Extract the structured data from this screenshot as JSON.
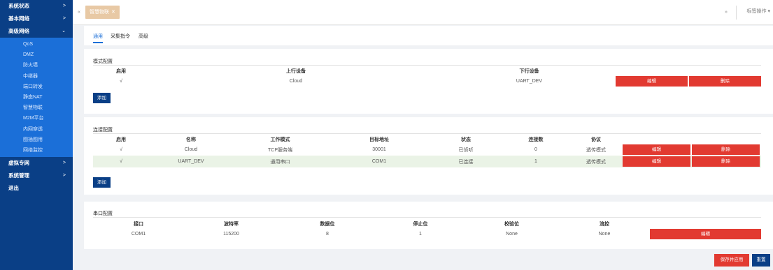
{
  "sidebar": {
    "top_items": [
      {
        "label": "系统状态",
        "chevron": ">"
      },
      {
        "label": "基本网络",
        "chevron": ">"
      },
      {
        "label": "高级网络",
        "chevron": "⌄"
      }
    ],
    "sub_items": [
      "QoS",
      "DMZ",
      "防火墙",
      "中继器",
      "端口转发",
      "静态NAT",
      "智慧物联",
      "M2M平台",
      "内网穿透",
      "图插图用",
      "网络监控"
    ],
    "bottom_items": [
      {
        "label": "虚拟专网",
        "chevron": ">"
      },
      {
        "label": "系统管理",
        "chevron": ">"
      },
      {
        "label": "退出",
        "chevron": ""
      }
    ]
  },
  "topbar": {
    "prev_icon": "«",
    "active_tab": "智慧物联",
    "close_icon": "✕",
    "next_icon": "»",
    "tab_ops": "标签操作 ▾"
  },
  "subtabs": [
    "通用",
    "采集指令",
    "高级"
  ],
  "mode_config": {
    "title": "模式配置",
    "headers": [
      "启用",
      "上行设备",
      "下行设备",
      ""
    ],
    "rows": [
      {
        "enabled": "√",
        "upstream": "Cloud",
        "downstream": "UART_DEV",
        "edit": "编辑",
        "delete": "删除"
      }
    ],
    "add": "添加"
  },
  "conn_config": {
    "title": "连接配置",
    "headers": [
      "启用",
      "名称",
      "工作模式",
      "目标地址",
      "状态",
      "连接数",
      "协议",
      ""
    ],
    "rows": [
      {
        "enabled": "√",
        "name": "Cloud",
        "mode": "TCP服务端",
        "target": "30001",
        "status": "已侦听",
        "conns": "0",
        "protocol": "透传模式",
        "edit": "编辑",
        "delete": "删除"
      },
      {
        "enabled": "√",
        "name": "UART_DEV",
        "mode": "通用串口",
        "target": "COM1",
        "status": "已连接",
        "conns": "1",
        "protocol": "透传模式",
        "edit": "编辑",
        "delete": "删除"
      }
    ],
    "add": "添加"
  },
  "serial_config": {
    "title": "串口配置",
    "headers": [
      "接口",
      "波特率",
      "数据位",
      "停止位",
      "校验位",
      "流控",
      ""
    ],
    "rows": [
      {
        "port": "COM1",
        "baud": "115200",
        "databits": "8",
        "stopbits": "1",
        "parity": "None",
        "flow": "None",
        "edit": "编辑"
      }
    ]
  },
  "actions": {
    "save": "保存并应用",
    "reset": "重置"
  },
  "colors": {
    "sidebar": "#0a3f86",
    "submenu": "#1b6fd8",
    "danger": "#e23a31",
    "primary": "#0a3f86",
    "active_tab": "#e8c9a5",
    "alt_row": "#eaf3e6"
  }
}
